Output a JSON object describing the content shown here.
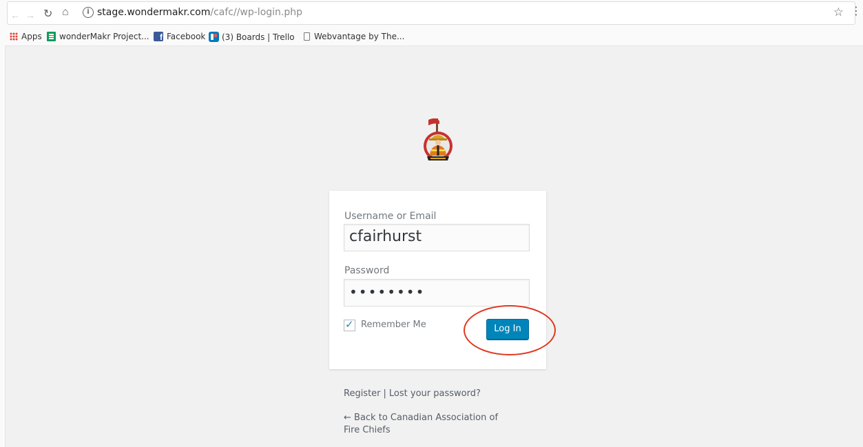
{
  "browser": {
    "url_host": "stage.wondermakr.com",
    "url_path": "/cafc//wp-login.php",
    "info_glyph": "i",
    "bookmarks": [
      {
        "label": "Apps",
        "icon": "apps-grid-icon"
      },
      {
        "label": "wonderMakr Project...",
        "icon": "sheets-icon"
      },
      {
        "label": "Facebook",
        "icon": "facebook-icon"
      },
      {
        "label": "(3) Boards | Trello",
        "icon": "trello-icon"
      },
      {
        "label": "Webvantage by The...",
        "icon": "page-icon"
      }
    ]
  },
  "login": {
    "username_label": "Username or Email",
    "username_value": "cfairhurst",
    "password_label": "Password",
    "password_value": "••••••••",
    "remember_label": "Remember Me",
    "remember_checked": true,
    "submit_label": "Log In"
  },
  "links": {
    "register": "Register",
    "separator": "|",
    "lost_password": "Lost your password?",
    "back": "← Back to Canadian Association of Fire Chiefs"
  },
  "colors": {
    "button": "#0085ba",
    "highlight_circle": "#e0361d",
    "background": "#f1f1f1"
  }
}
